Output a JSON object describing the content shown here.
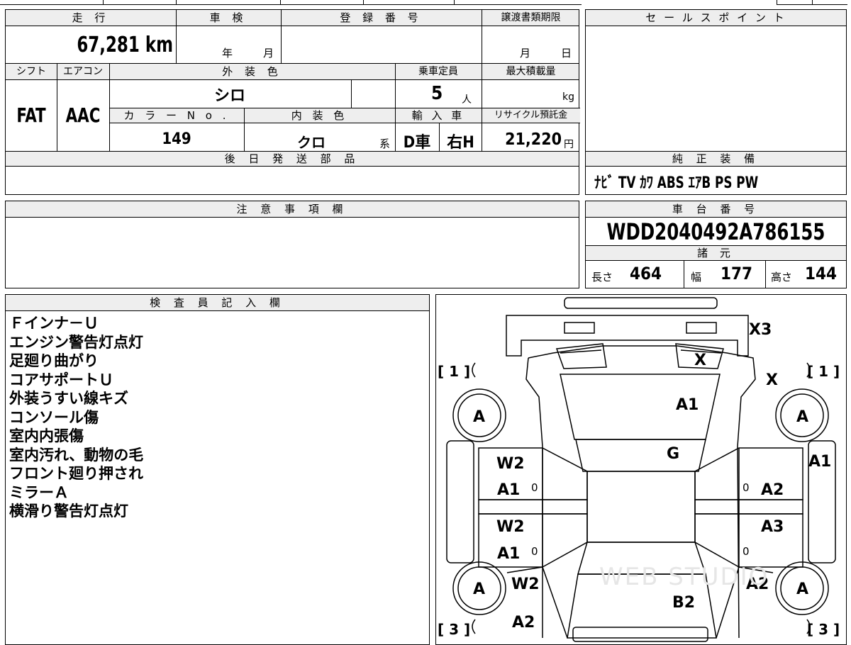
{
  "mileage": {
    "label": "走 行",
    "value": "67,281 km"
  },
  "shaken": {
    "label": "車 検",
    "year_unit": "年",
    "month_unit": "月"
  },
  "registration": {
    "label": "登 録 番 号",
    "value": ""
  },
  "transfer_deadline": {
    "label": "譲渡書類期限",
    "month_unit": "月",
    "day_unit": "日"
  },
  "sales_point": {
    "label": "セ ー ル ス ポ イ ン ト",
    "value": ""
  },
  "shift": {
    "label": "シフト",
    "value": "FAT"
  },
  "aircon": {
    "label": "エアコン",
    "value": "AAC"
  },
  "exterior_color": {
    "label": "外 装 色",
    "value": "シロ"
  },
  "capacity": {
    "label": "乗車定員",
    "value": "5",
    "unit": "人"
  },
  "max_load": {
    "label": "最大積載量",
    "unit": "kg"
  },
  "color_no": {
    "label": "カ ラ ー N o .",
    "value": "149"
  },
  "interior_color": {
    "label": "内 装 色",
    "value": "クロ",
    "suffix": "系"
  },
  "import": {
    "label": "輸 入 車",
    "value1": "D車",
    "value2": "右H"
  },
  "recycle": {
    "label": "リサイクル預託金",
    "value": "21,220",
    "unit": "円"
  },
  "later_parts": {
    "label": "後 日 発 送 部 品",
    "value": ""
  },
  "genuine_equipment": {
    "label": "純 正 装 備",
    "value": "ﾅﾋﾞ TV ｶﾜ ABS ｴｱB PS PW"
  },
  "notes": {
    "label": "注 意 事 項 欄",
    "value": ""
  },
  "chassis_no": {
    "label": "車 台 番 号",
    "value": "WDD2040492A786155"
  },
  "specs": {
    "label": "諸 元",
    "length_label": "長さ",
    "length": "464",
    "width_label": "幅",
    "width": "177",
    "height_label": "高さ",
    "height": "144"
  },
  "inspector": {
    "label": "検 査 員 記 入 欄",
    "lines": [
      "Ｆインナ－Ｕ",
      "エンジン警告灯点灯",
      "足廻り曲がり",
      "コアサポートＵ",
      "外装うすい線キズ",
      "コンソール傷",
      "室内内張傷",
      "室内汚れ、動物の毛",
      "フロント廻り押され",
      "ミラーＡ",
      "横滑り警告灯点灯"
    ]
  },
  "diagram": {
    "marks": {
      "x3": "X3",
      "x_left": "X",
      "x_right": "X",
      "a1_hood": "A1",
      "g_roof": "G",
      "a1_right_fender": "A1",
      "w2_left_front": "W2",
      "a1_left_front": "A1",
      "a2_right_front": "A2",
      "w2_left_rear": "W2",
      "a1_left_rear": "A1",
      "a3_right_rear": "A3",
      "w2_left_quarter": "W2",
      "a2_right_quarter": "A2",
      "b2_trunk": "B2",
      "a2_rear_left": "A2"
    },
    "wheels": {
      "fl": "A",
      "fr": "A",
      "rl": "A",
      "rr": "A"
    },
    "corners": {
      "fl": "[ 1 ]",
      "fr": "[ 1 ]",
      "rl": "[ 3 ]",
      "rr": "[ 3 ]"
    },
    "door_zero": "0",
    "watermark": "WEB STUDIO"
  }
}
